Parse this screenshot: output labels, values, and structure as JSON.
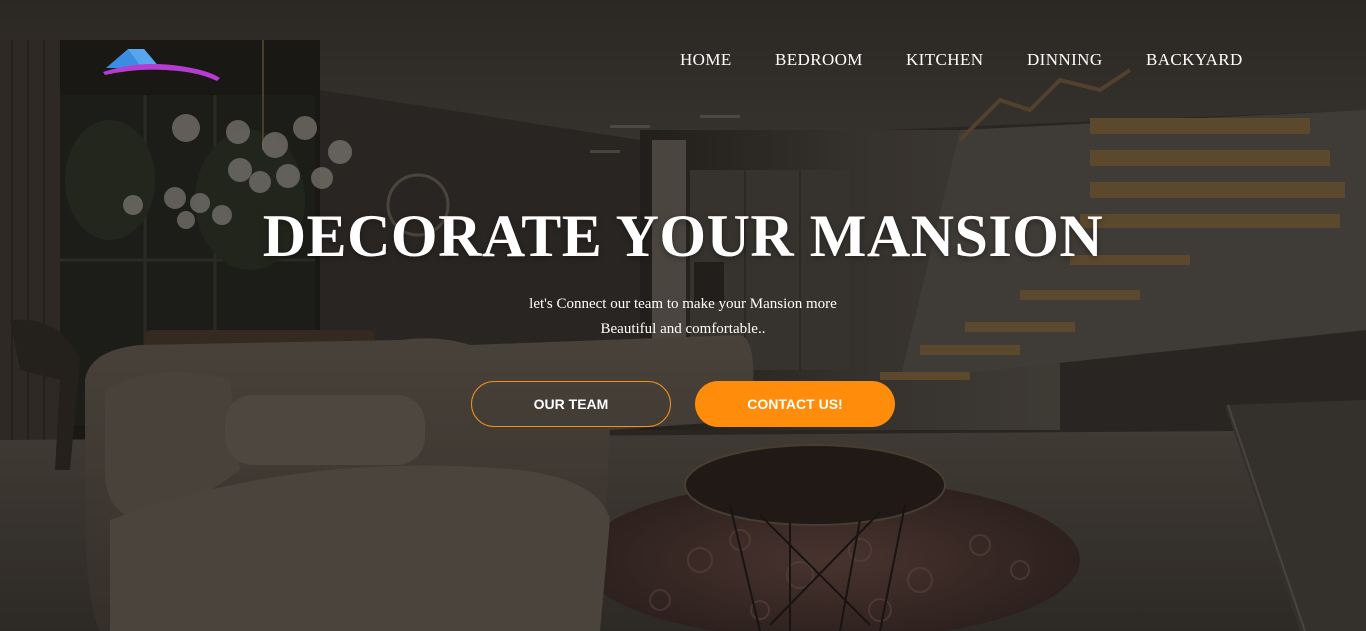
{
  "nav": {
    "items": [
      {
        "label": "HOME"
      },
      {
        "label": "BEDROOM"
      },
      {
        "label": "KITCHEN"
      },
      {
        "label": "DINNING"
      },
      {
        "label": "BACKYARD"
      }
    ]
  },
  "hero": {
    "headline": "DECORATE YOUR MANSION",
    "subtitle_line1": "let's Connect our team to make your Mansion more",
    "subtitle_line2": "Beautiful and comfortable..",
    "team_button": "OUR TEAM",
    "contact_button": "CONTACT US!"
  },
  "colors": {
    "accent": "#ff8c0a",
    "logo_roof": "#3a8de0",
    "logo_swoosh": "#b43cd0"
  },
  "icons": {
    "logo": "house-roof-logo-icon"
  }
}
